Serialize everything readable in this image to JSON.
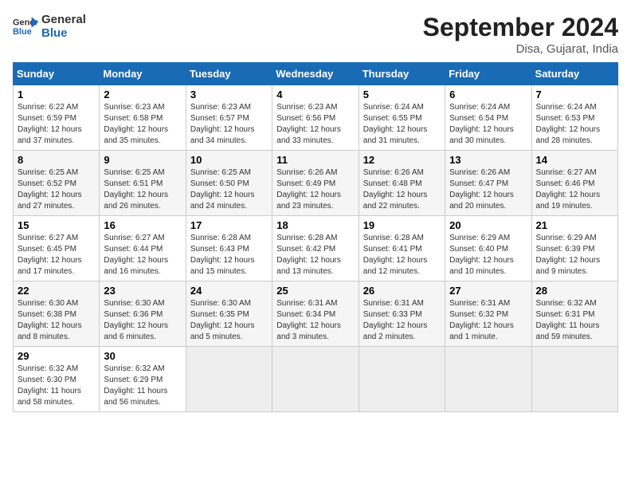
{
  "logo": {
    "line1": "General",
    "line2": "Blue"
  },
  "title": "September 2024",
  "location": "Disa, Gujarat, India",
  "days_of_week": [
    "Sunday",
    "Monday",
    "Tuesday",
    "Wednesday",
    "Thursday",
    "Friday",
    "Saturday"
  ],
  "weeks": [
    [
      {
        "day": 1,
        "sunrise": "6:22 AM",
        "sunset": "6:59 PM",
        "daylight": "12 hours and 37 minutes."
      },
      {
        "day": 2,
        "sunrise": "6:23 AM",
        "sunset": "6:58 PM",
        "daylight": "12 hours and 35 minutes."
      },
      {
        "day": 3,
        "sunrise": "6:23 AM",
        "sunset": "6:57 PM",
        "daylight": "12 hours and 34 minutes."
      },
      {
        "day": 4,
        "sunrise": "6:23 AM",
        "sunset": "6:56 PM",
        "daylight": "12 hours and 33 minutes."
      },
      {
        "day": 5,
        "sunrise": "6:24 AM",
        "sunset": "6:55 PM",
        "daylight": "12 hours and 31 minutes."
      },
      {
        "day": 6,
        "sunrise": "6:24 AM",
        "sunset": "6:54 PM",
        "daylight": "12 hours and 30 minutes."
      },
      {
        "day": 7,
        "sunrise": "6:24 AM",
        "sunset": "6:53 PM",
        "daylight": "12 hours and 28 minutes."
      }
    ],
    [
      {
        "day": 8,
        "sunrise": "6:25 AM",
        "sunset": "6:52 PM",
        "daylight": "12 hours and 27 minutes."
      },
      {
        "day": 9,
        "sunrise": "6:25 AM",
        "sunset": "6:51 PM",
        "daylight": "12 hours and 26 minutes."
      },
      {
        "day": 10,
        "sunrise": "6:25 AM",
        "sunset": "6:50 PM",
        "daylight": "12 hours and 24 minutes."
      },
      {
        "day": 11,
        "sunrise": "6:26 AM",
        "sunset": "6:49 PM",
        "daylight": "12 hours and 23 minutes."
      },
      {
        "day": 12,
        "sunrise": "6:26 AM",
        "sunset": "6:48 PM",
        "daylight": "12 hours and 22 minutes."
      },
      {
        "day": 13,
        "sunrise": "6:26 AM",
        "sunset": "6:47 PM",
        "daylight": "12 hours and 20 minutes."
      },
      {
        "day": 14,
        "sunrise": "6:27 AM",
        "sunset": "6:46 PM",
        "daylight": "12 hours and 19 minutes."
      }
    ],
    [
      {
        "day": 15,
        "sunrise": "6:27 AM",
        "sunset": "6:45 PM",
        "daylight": "12 hours and 17 minutes."
      },
      {
        "day": 16,
        "sunrise": "6:27 AM",
        "sunset": "6:44 PM",
        "daylight": "12 hours and 16 minutes."
      },
      {
        "day": 17,
        "sunrise": "6:28 AM",
        "sunset": "6:43 PM",
        "daylight": "12 hours and 15 minutes."
      },
      {
        "day": 18,
        "sunrise": "6:28 AM",
        "sunset": "6:42 PM",
        "daylight": "12 hours and 13 minutes."
      },
      {
        "day": 19,
        "sunrise": "6:28 AM",
        "sunset": "6:41 PM",
        "daylight": "12 hours and 12 minutes."
      },
      {
        "day": 20,
        "sunrise": "6:29 AM",
        "sunset": "6:40 PM",
        "daylight": "12 hours and 10 minutes."
      },
      {
        "day": 21,
        "sunrise": "6:29 AM",
        "sunset": "6:39 PM",
        "daylight": "12 hours and 9 minutes."
      }
    ],
    [
      {
        "day": 22,
        "sunrise": "6:30 AM",
        "sunset": "6:38 PM",
        "daylight": "12 hours and 8 minutes."
      },
      {
        "day": 23,
        "sunrise": "6:30 AM",
        "sunset": "6:36 PM",
        "daylight": "12 hours and 6 minutes."
      },
      {
        "day": 24,
        "sunrise": "6:30 AM",
        "sunset": "6:35 PM",
        "daylight": "12 hours and 5 minutes."
      },
      {
        "day": 25,
        "sunrise": "6:31 AM",
        "sunset": "6:34 PM",
        "daylight": "12 hours and 3 minutes."
      },
      {
        "day": 26,
        "sunrise": "6:31 AM",
        "sunset": "6:33 PM",
        "daylight": "12 hours and 2 minutes."
      },
      {
        "day": 27,
        "sunrise": "6:31 AM",
        "sunset": "6:32 PM",
        "daylight": "12 hours and 1 minute."
      },
      {
        "day": 28,
        "sunrise": "6:32 AM",
        "sunset": "6:31 PM",
        "daylight": "11 hours and 59 minutes."
      }
    ],
    [
      {
        "day": 29,
        "sunrise": "6:32 AM",
        "sunset": "6:30 PM",
        "daylight": "11 hours and 58 minutes."
      },
      {
        "day": 30,
        "sunrise": "6:32 AM",
        "sunset": "6:29 PM",
        "daylight": "11 hours and 56 minutes."
      },
      null,
      null,
      null,
      null,
      null
    ]
  ]
}
